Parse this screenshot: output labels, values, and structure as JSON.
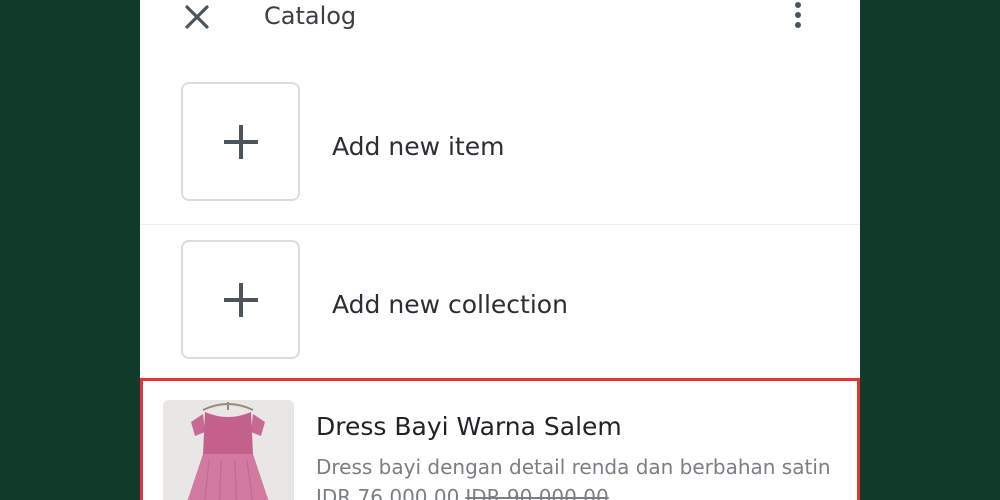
{
  "header": {
    "title": "Catalog",
    "close_icon": "close-icon",
    "menu_icon": "more-vertical-icon"
  },
  "actions": [
    {
      "label": "Add new item",
      "icon": "plus-icon"
    },
    {
      "label": "Add new collection",
      "icon": "plus-icon"
    }
  ],
  "product": {
    "name": "Dress Bayi Warna Salem",
    "description": "Dress bayi dengan detail renda dan berbahan satin",
    "price": "IDR 76.000,00",
    "original_price": "IDR 90.000,00"
  },
  "colors": {
    "background": "#113a29",
    "highlight_border": "#e0363b",
    "icon": "#4a545c"
  }
}
